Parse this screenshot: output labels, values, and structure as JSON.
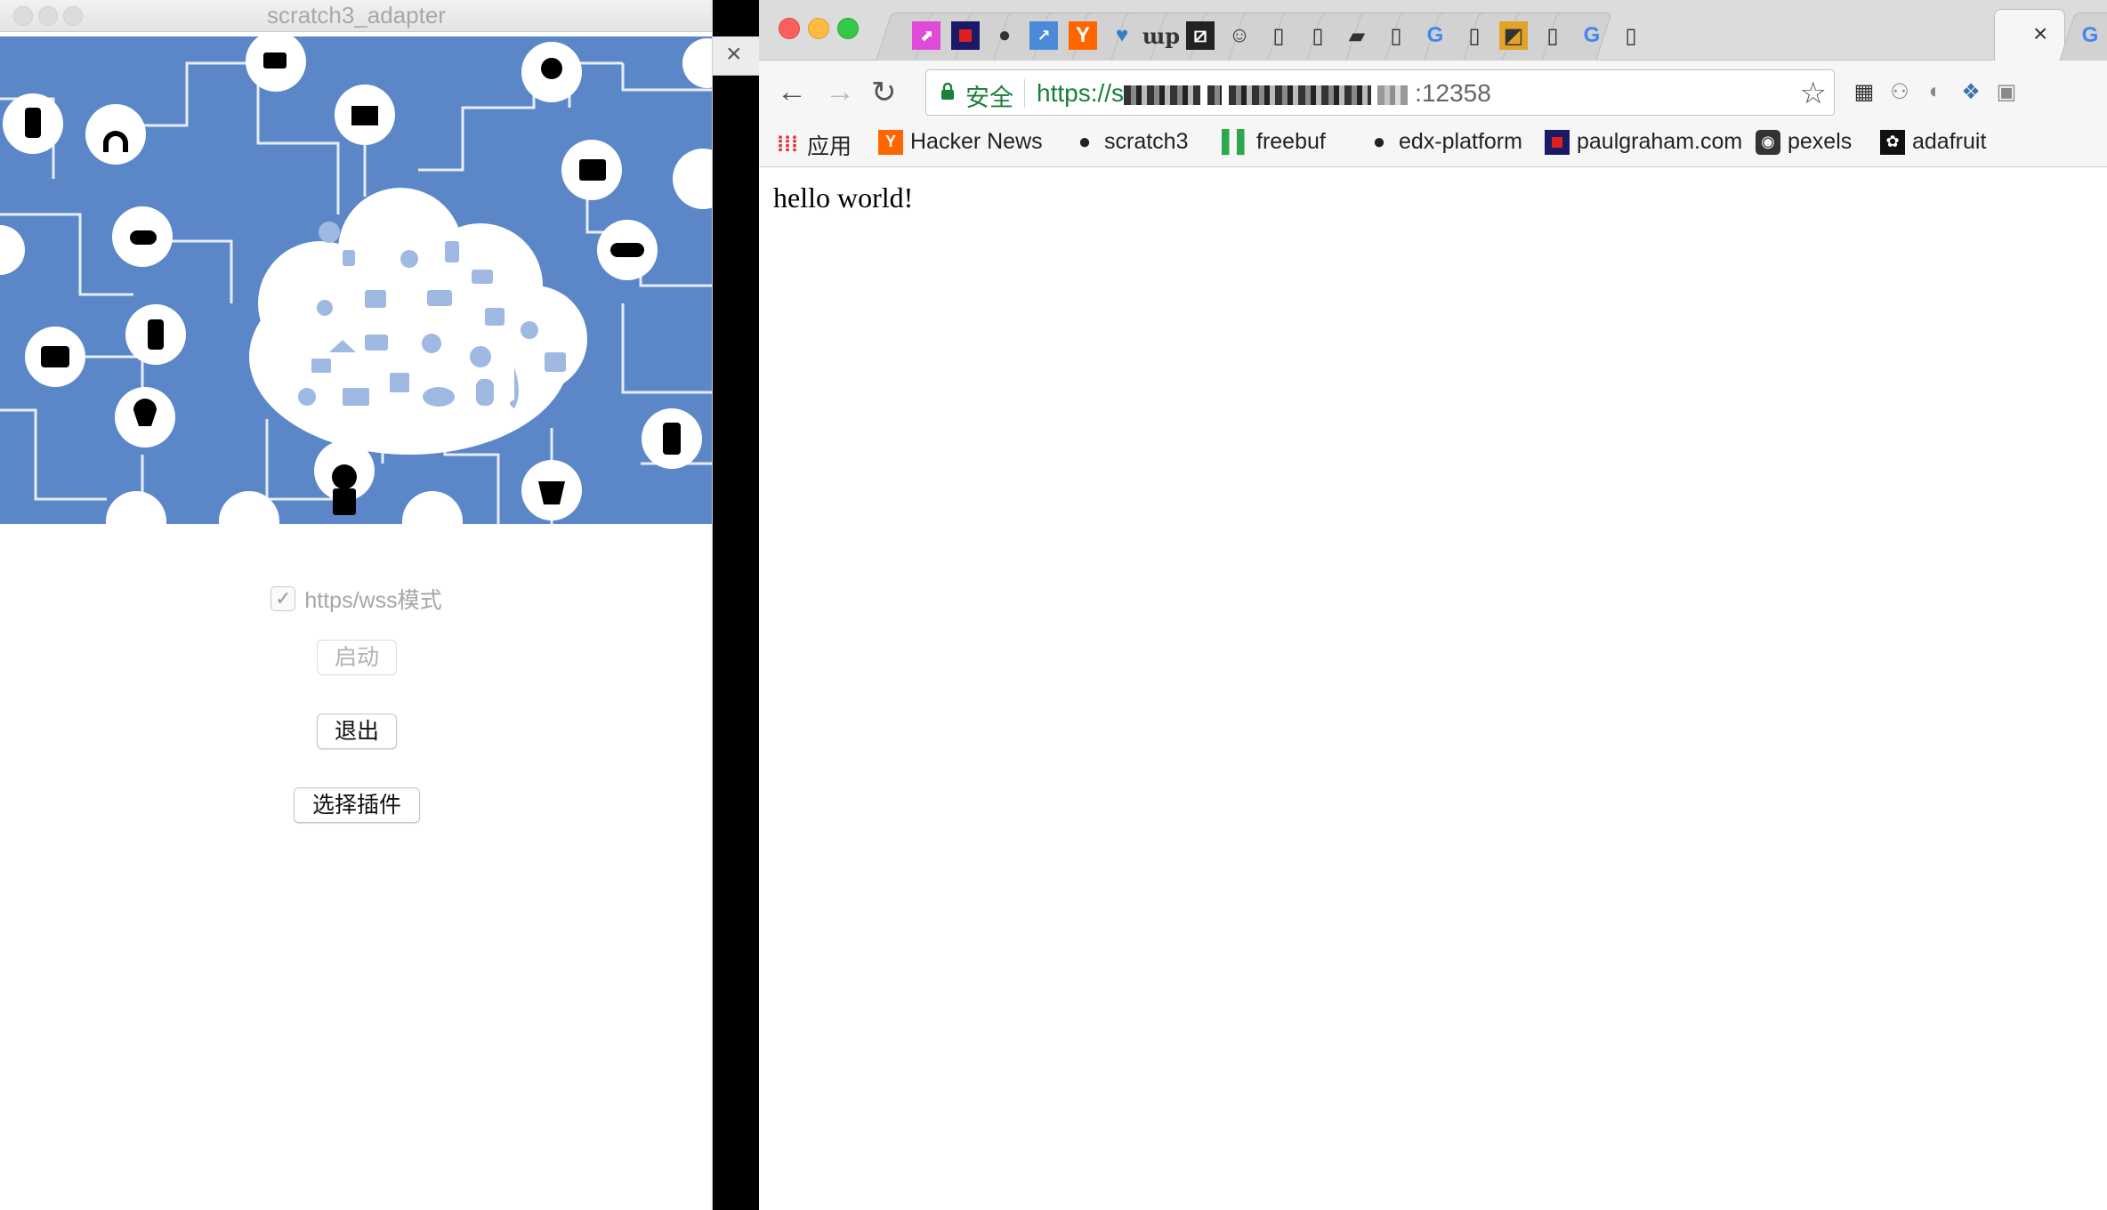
{
  "app": {
    "title": "scratch3_adapter",
    "https_checkbox_label": "https/wss模式",
    "https_checked": true,
    "start_button": "启动",
    "quit_button": "退出",
    "plugin_button": "选择插件",
    "close_glyph": "×"
  },
  "browser": {
    "secure_label": "安全",
    "url_prefix": "https://s",
    "url_suffix": ":12358",
    "page_text": "hello world!",
    "tab_close_glyph": "×",
    "bookmarks": [
      {
        "label": "应用",
        "icon": "apps-grid-icon"
      },
      {
        "label": "Hacker News",
        "icon": "y-icon"
      },
      {
        "label": "scratch3",
        "icon": "github-icon"
      },
      {
        "label": "freebuf",
        "icon": "freebuf-icon"
      },
      {
        "label": "edx-platform",
        "icon": "github-icon"
      },
      {
        "label": "paulgraham.com",
        "icon": "pg-icon"
      },
      {
        "label": "pexels",
        "icon": "camera-icon"
      },
      {
        "label": "adafruit",
        "icon": "star-flower-icon"
      }
    ]
  },
  "colors": {
    "banner_blue": "#5b87c9",
    "secure_green": "#188038"
  }
}
